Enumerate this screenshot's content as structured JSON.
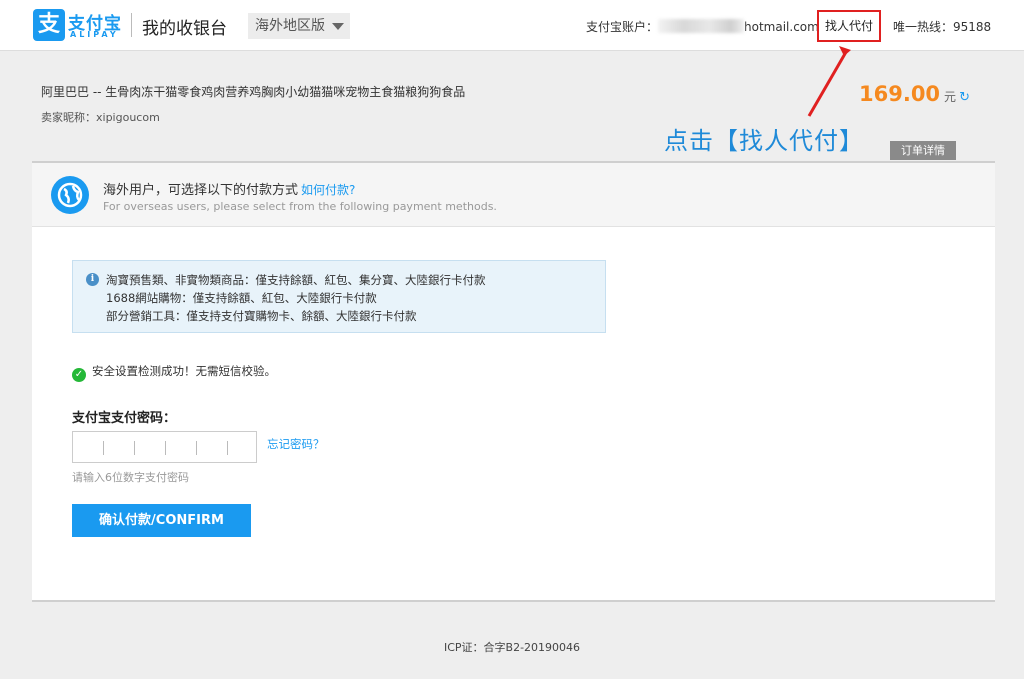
{
  "header": {
    "logo_mark": "支",
    "logo_cn": "支付宝",
    "logo_en": "ALIPAY",
    "title": "我的收银台",
    "region": "海外地区版",
    "account_label": "支付宝账户：",
    "account_suffix": "hotmail.com",
    "find_pay": "找人代付",
    "hotline": "唯一热线：95188"
  },
  "order": {
    "product": "阿里巴巴 -- 生骨肉冻干猫零食鸡肉营养鸡胸肉小幼猫猫咪宠物主食猫粮狗狗食品",
    "seller": "卖家昵称：xipigoucom",
    "price": "169.00",
    "unit": "元",
    "detail_button": "订单详情"
  },
  "annotation": "点击【找人代付】",
  "notice": {
    "cn": "海外用户，可选择以下的付款方式",
    "link": "如何付款?",
    "en": "For overseas users, please select from the following payment methods."
  },
  "info_lines": [
    "淘寶預售類、非實物類商品：僅支持餘額、紅包、集分寶、大陸銀行卡付款",
    "1688網站購物：僅支持餘額、紅包、大陸銀行卡付款",
    "部分營銷工具：僅支持支付寶購物卡、餘額、大陸銀行卡付款"
  ],
  "security_msg": "安全设置检测成功！无需短信校验。",
  "password": {
    "label": "支付宝支付密码：",
    "forgot": "忘记密码？",
    "hint": "请输入6位数字支付密码"
  },
  "confirm_button": "确认付款/CONFIRM",
  "footer": "ICP证：合字B2-20190046",
  "colors": {
    "brand": "#1a9af0",
    "price": "#f5891f",
    "highlight": "#e02020",
    "success": "#25b838"
  }
}
